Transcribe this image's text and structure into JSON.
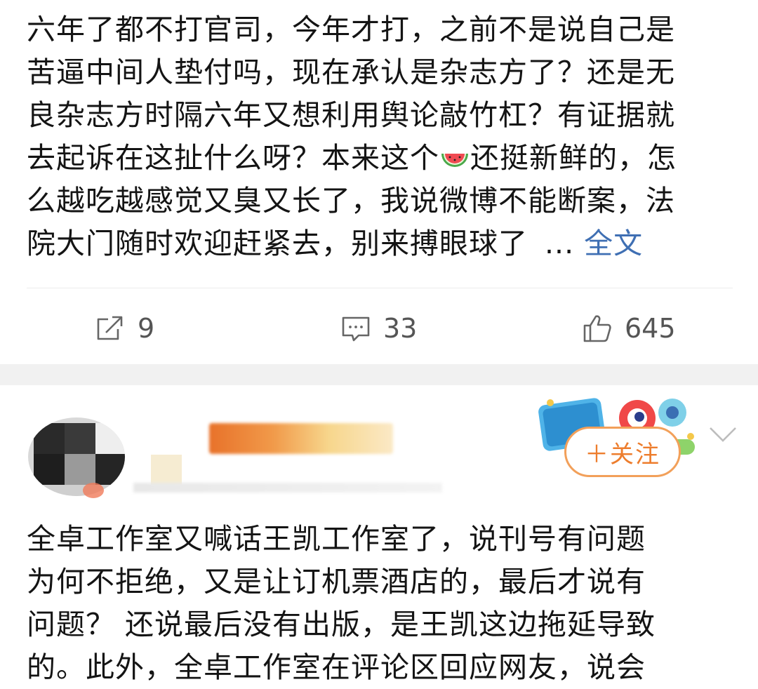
{
  "post1": {
    "text_before_emoji": "六年了都不打官司，今年才打，之前不是说自己是\n苦逼中间人垫付吗，现在承认是杂志方了？还是无\n良杂志方时隔六年又想利用舆论敲竹杠？有证据就\n去起诉在这扯什么呀？本来这个",
    "emoji": "watermelon-emoji",
    "text_after_emoji": "还挺新鲜的，怎\n么越吃越感觉又臭又长了，我说微博不能断案，法\n院大门随时欢迎赶紧去，别来搏眼球了",
    "ellipsis": "...",
    "full_text_link": "全文",
    "actions": {
      "repost_icon": "repost-icon",
      "repost_count": "9",
      "comment_icon": "comment-icon",
      "comment_count": "33",
      "like_icon": "thumbs-up-icon",
      "like_count": "645"
    }
  },
  "post2": {
    "follow_label": "＋关注",
    "badge_icon": "national-day-movie-badge",
    "more_icon": "chevron-down-icon",
    "text": "全卓工作室又喊话王凯工作室了，说刊号有问题\n为何不拒绝，又是让订机票酒店的，最后才说有\n问题？ 还说最后没有出版，是王凯这边拖延导致\n的。此外，全卓工作室在评论区回应网友，说会"
  },
  "colors": {
    "link": "#3f6fb3",
    "follow_orange": "#ed7d2d",
    "follow_border": "#f2a05a",
    "action_gray": "#555555",
    "separator": "#f1f1f1"
  }
}
